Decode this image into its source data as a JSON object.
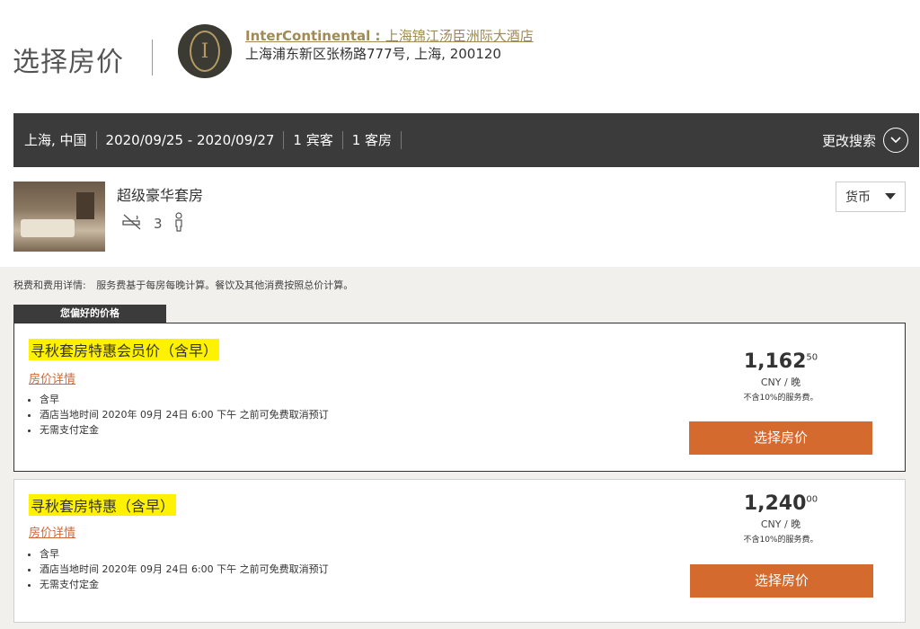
{
  "header": {
    "page_title": "选择房价",
    "hotel_name_brand": "InterContinental : ",
    "hotel_name_local": "上海锦江汤臣洲际大酒店",
    "hotel_address": "上海浦东新区张杨路777号, 上海, 200120",
    "logo_letter": "I"
  },
  "search": {
    "location": "上海, 中国",
    "dates": "2020/09/25 - 2020/09/27",
    "guests": "1 宾客",
    "rooms": "1 客房",
    "change_label": "更改搜索",
    "change_icon": "chevron-down-icon"
  },
  "room": {
    "name": "超级豪华套房",
    "occupancy": "3",
    "icons": [
      "no-smoking-icon",
      "person-icon"
    ]
  },
  "currency": {
    "label": "货币"
  },
  "tax": {
    "label": "税费和费用详情:",
    "text": "服务费基于每房每晚计算。餐饮及其他消费按照总价计算。"
  },
  "preferred_tab": "您偏好的价格",
  "rates": [
    {
      "title": "寻秋套房特惠会员价（含早）",
      "details_link": "房价详情",
      "features": [
        "含早",
        "酒店当地时间 2020年 09月 24日 6:00 下午 之前可免费取消预订",
        "无需支付定金"
      ],
      "price_main": "1,162",
      "price_cents": "50",
      "unit": "CNY / 晚",
      "note": "不含10%的服务费。",
      "button": "选择房价"
    },
    {
      "title": "寻秋套房特惠（含早）",
      "details_link": "房价详情",
      "features": [
        "含早",
        "酒店当地时间 2020年 09月 24日 6:00 下午 之前可免费取消预订",
        "无需支付定金"
      ],
      "price_main": "1,240",
      "price_cents": "00",
      "unit": "CNY / 晚",
      "note": "不含10%的服务费。",
      "button": "选择房价"
    }
  ],
  "colors": {
    "accent": "#d56a2e",
    "brand_gold": "#a08a55",
    "dark_bar": "#3b3b3b",
    "highlight": "#fff200"
  }
}
